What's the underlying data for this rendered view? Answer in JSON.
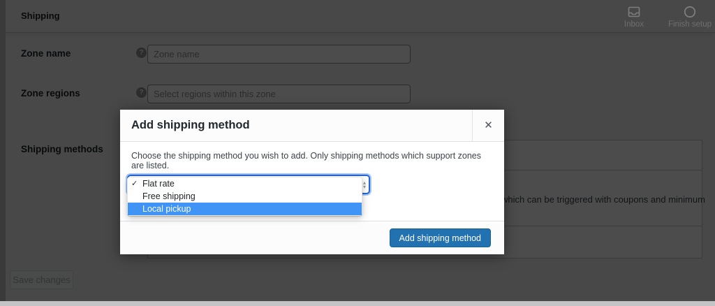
{
  "colors": {
    "accent_blue": "#2271b1",
    "menu_highlight_blue": "#3f94f5",
    "backdrop": "rgba(0,0,0,0.7)"
  },
  "header": {
    "title": "Shipping",
    "inbox_label": "Inbox",
    "finish_setup_label": "Finish setup"
  },
  "form": {
    "zone_name": {
      "label": "Zone name",
      "placeholder": "Zone name"
    },
    "zone_regions": {
      "label": "Zone regions",
      "placeholder": "Select regions within this zone"
    },
    "shipping_methods": {
      "label": "Shipping methods",
      "visible_description_fragment": "which can be triggered with coupons and minimum"
    },
    "save_button_label": "Save changes"
  },
  "modal": {
    "title": "Add shipping method",
    "close_glyph": "✕",
    "description": "Choose the shipping method you wish to add. Only shipping methods which support zones are listed.",
    "dropdown": {
      "check_glyph": "✓",
      "options": [
        {
          "label": "Flat rate",
          "checked": true,
          "highlighted": false
        },
        {
          "label": "Free shipping",
          "checked": false,
          "highlighted": false
        },
        {
          "label": "Local pickup",
          "checked": false,
          "highlighted": true
        }
      ]
    },
    "submit_button_label": "Add shipping method"
  }
}
